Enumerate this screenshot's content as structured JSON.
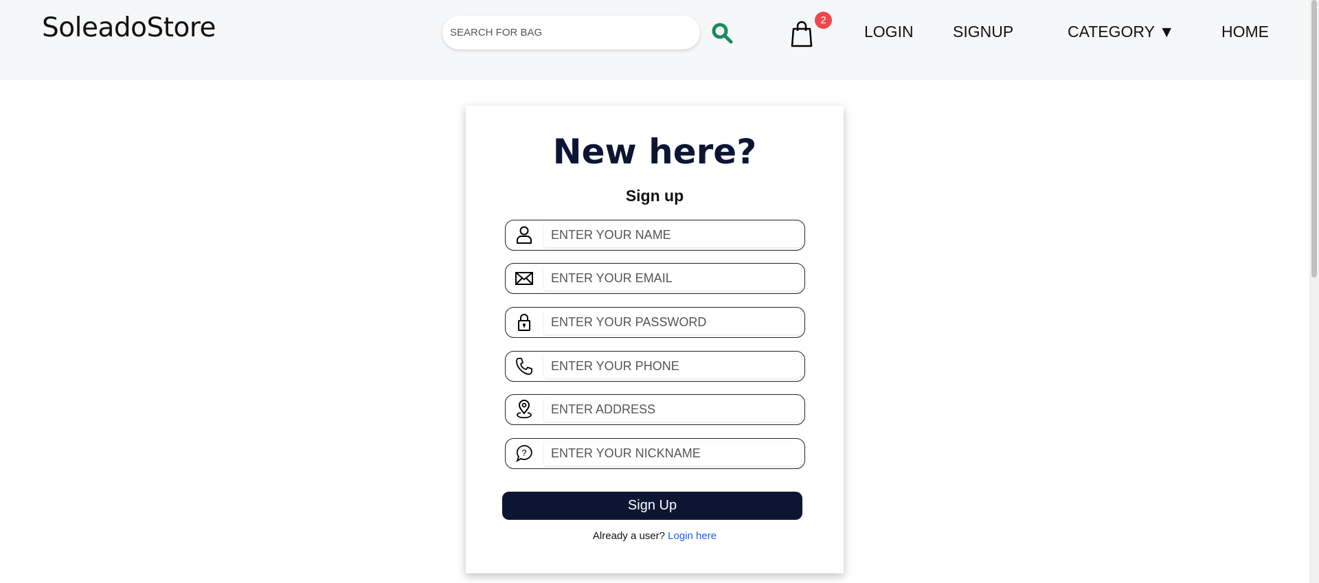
{
  "header": {
    "logo": "SoleadoStore",
    "search_placeholder": "SEARCH FOR BAG",
    "cart_count": "2",
    "nav": {
      "login": "LOGIN",
      "signup": "SIGNUP",
      "category": "CATEGORY ▼",
      "home": "HOME"
    },
    "colors": {
      "search_icon": "#1e8a5a",
      "badge": "#f0474b"
    }
  },
  "form": {
    "title": "New here?",
    "subtitle": "Sign up",
    "fields": [
      {
        "icon": "user-icon",
        "placeholder": "ENTER YOUR NAME"
      },
      {
        "icon": "envelope-icon",
        "placeholder": "ENTER YOUR EMAIL"
      },
      {
        "icon": "lock-icon",
        "placeholder": "ENTER YOUR PASSWORD"
      },
      {
        "icon": "phone-icon",
        "placeholder": "ENTER YOUR PHONE"
      },
      {
        "icon": "location-pin-icon",
        "placeholder": "ENTER ADDRESS"
      },
      {
        "icon": "question-bubble-icon",
        "placeholder": "ENTER YOUR NICKNAME"
      }
    ],
    "submit_label": "Sign Up",
    "already_text": "Already a user?",
    "login_link": "Login here",
    "colors": {
      "primary": "#0c1633",
      "link": "#1a5cff"
    }
  }
}
